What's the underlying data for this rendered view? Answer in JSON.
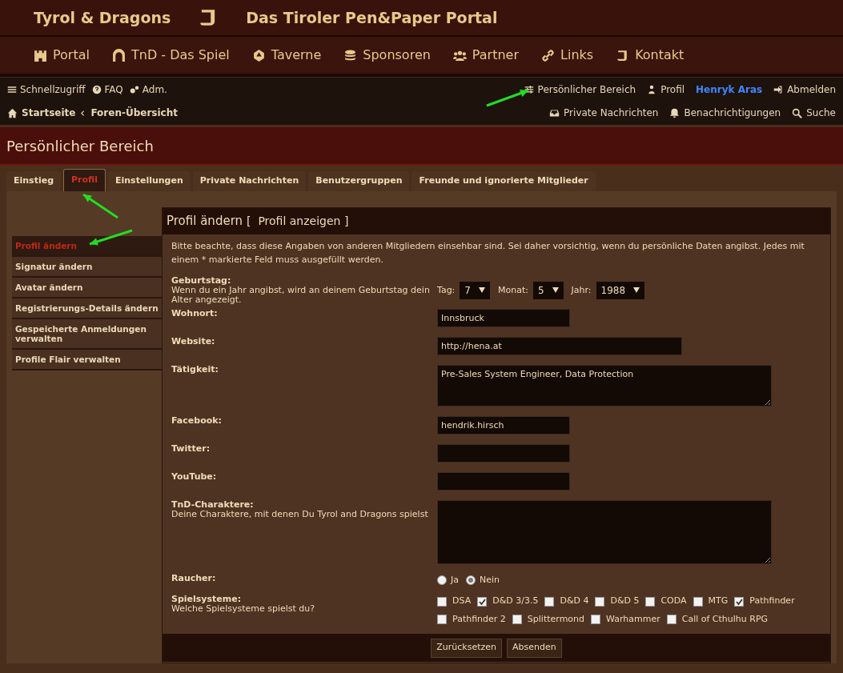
{
  "site": {
    "title": "Tyrol & Dragons",
    "subtitle": "Das Tiroler Pen&Paper Portal"
  },
  "nav": [
    {
      "label": "Portal"
    },
    {
      "label": "TnD - Das Spiel"
    },
    {
      "label": "Taverne"
    },
    {
      "label": "Sponsoren"
    },
    {
      "label": "Partner"
    },
    {
      "label": "Links"
    },
    {
      "label": "Kontakt"
    }
  ],
  "quick_links": [
    {
      "label": "Schnellzugriff"
    },
    {
      "label": "FAQ"
    },
    {
      "label": "Adm."
    }
  ],
  "user_links": [
    {
      "label": "Persönlicher Bereich",
      "kind": "link"
    },
    {
      "label": "Profil",
      "kind": "link"
    },
    {
      "label": "Henryk Aras",
      "kind": "username"
    },
    {
      "label": "Abmelden",
      "kind": "link"
    }
  ],
  "breadcrumbs": [
    "Startseite",
    "Foren-Übersicht"
  ],
  "secondary_links": [
    {
      "label": "Private Nachrichten"
    },
    {
      "label": "Benachrichtigungen"
    },
    {
      "label": "Suche"
    }
  ],
  "page_title": "Persönlicher Bereich",
  "tabs": [
    {
      "label": "Einstieg",
      "selected": false
    },
    {
      "label": "Profil",
      "selected": true
    },
    {
      "label": "Einstellungen",
      "selected": false
    },
    {
      "label": "Private Nachrichten",
      "selected": false
    },
    {
      "label": "Benutzergruppen",
      "selected": false
    },
    {
      "label": "Freunde und ignorierte Mitglieder",
      "selected": false
    }
  ],
  "sidebar": {
    "items": [
      {
        "label": "Profil ändern",
        "selected": true
      },
      {
        "label": "Signatur ändern",
        "selected": false
      },
      {
        "label": "Avatar ändern",
        "selected": false
      },
      {
        "label": "Registrierungs-Details ändern",
        "selected": false
      },
      {
        "label": "Gespeicherte Anmeldungen verwalten",
        "selected": false
      },
      {
        "label": "Profile Flair verwalten",
        "selected": false
      }
    ]
  },
  "panel": {
    "title": "Profil ändern",
    "title_link": "[  Profil anzeigen ]",
    "notice": "Bitte beachte, dass diese Angaben von anderen Mitgliedern einsehbar sind. Sei daher vorsichtig, wenn du persönliche Daten angibst. Jedes mit einem * markierte Feld muss ausgefüllt werden.",
    "fields": [
      {
        "kind": "date",
        "label": "Geburtstag:",
        "hint": "Wenn du ein Jahr angibst, wird an deinem Geburtstag dein Alter angezeigt.",
        "selects": [
          {
            "label": "Tag:",
            "value": "7"
          },
          {
            "label": "Monat:",
            "value": "5"
          },
          {
            "label": "Jahr:",
            "value": "1988"
          }
        ]
      },
      {
        "kind": "text",
        "label": "Wohnort:",
        "value": "Innsbruck"
      },
      {
        "kind": "wide_text",
        "label": "Website:",
        "value": "http://hena.at"
      },
      {
        "kind": "textarea",
        "label": "Tätigkeit:",
        "value": "Pre-Sales System Engineer, Data Protection"
      },
      {
        "kind": "text",
        "label": "Facebook:",
        "value": "hendrik.hirsch"
      },
      {
        "kind": "text",
        "label": "Twitter:"
      },
      {
        "kind": "text",
        "label": "YouTube:"
      },
      {
        "kind": "tall_textarea",
        "label": "TnD-Charaktere:",
        "hint": "Deine Charaktere, mit denen Du Tyrol and Dragons spielst"
      },
      {
        "kind": "radio",
        "label": "Raucher:",
        "options": [
          {
            "label": "Ja",
            "selected": false
          },
          {
            "label": "Nein",
            "selected": true
          }
        ]
      },
      {
        "kind": "checkboxes",
        "label": "Spielsysteme:",
        "hint": "Welche Spielsysteme spielst du?",
        "options": [
          {
            "label": "DSA",
            "checked": false
          },
          {
            "label": "D&D 3/3.5",
            "checked": true
          },
          {
            "label": "D&D 4",
            "checked": false
          },
          {
            "label": "D&D 5",
            "checked": false
          },
          {
            "label": "CODA",
            "checked": false
          },
          {
            "label": "MTG",
            "checked": false
          },
          {
            "label": "Pathfinder",
            "checked": true
          },
          {
            "label": "Pathfinder 2",
            "checked": false
          },
          {
            "label": "Splittermond",
            "checked": false
          },
          {
            "label": "Warhammer",
            "checked": false
          },
          {
            "label": "Call of Cthulhu RPG",
            "checked": false
          }
        ]
      }
    ],
    "buttons": [
      "Zurücksetzen",
      "Absenden"
    ]
  }
}
